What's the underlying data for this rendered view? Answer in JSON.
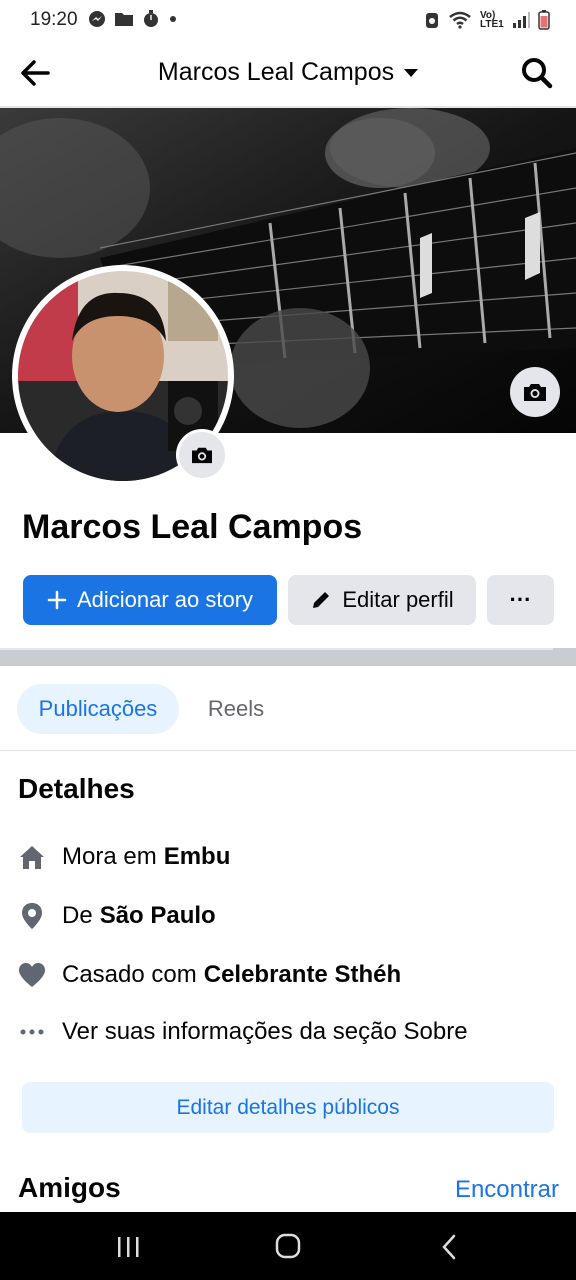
{
  "status_bar": {
    "time": "19:20",
    "network_label": "Vo) LTE1"
  },
  "header": {
    "title": "Marcos Leal Campos"
  },
  "profile": {
    "name": "Marcos Leal Campos",
    "add_story_label": "Adicionar ao story",
    "edit_profile_label": "Editar perfil",
    "more_label": "···"
  },
  "tabs": [
    {
      "label": "Publicações",
      "active": true
    },
    {
      "label": "Reels",
      "active": false
    }
  ],
  "details": {
    "title": "Detalhes",
    "items": [
      {
        "icon": "home-icon",
        "prefix": "Mora em",
        "value": "Embu"
      },
      {
        "icon": "location-pin-icon",
        "prefix": "De",
        "value": "São Paulo"
      },
      {
        "icon": "heart-icon",
        "prefix": "Casado com",
        "value": "Celebrante Sthéh"
      },
      {
        "icon": "more-dots-icon",
        "prefix": "Ver suas informações da seção Sobre",
        "value": ""
      }
    ],
    "edit_button_label": "Editar detalhes públicos"
  },
  "friends": {
    "title": "Amigos",
    "find_label": "Encontrar"
  },
  "colors": {
    "accent": "#1b74e4",
    "accent_light": "#e7f3ff",
    "button_gray": "#e4e6eb",
    "text": "#050505",
    "secondary_text": "#65676b"
  }
}
